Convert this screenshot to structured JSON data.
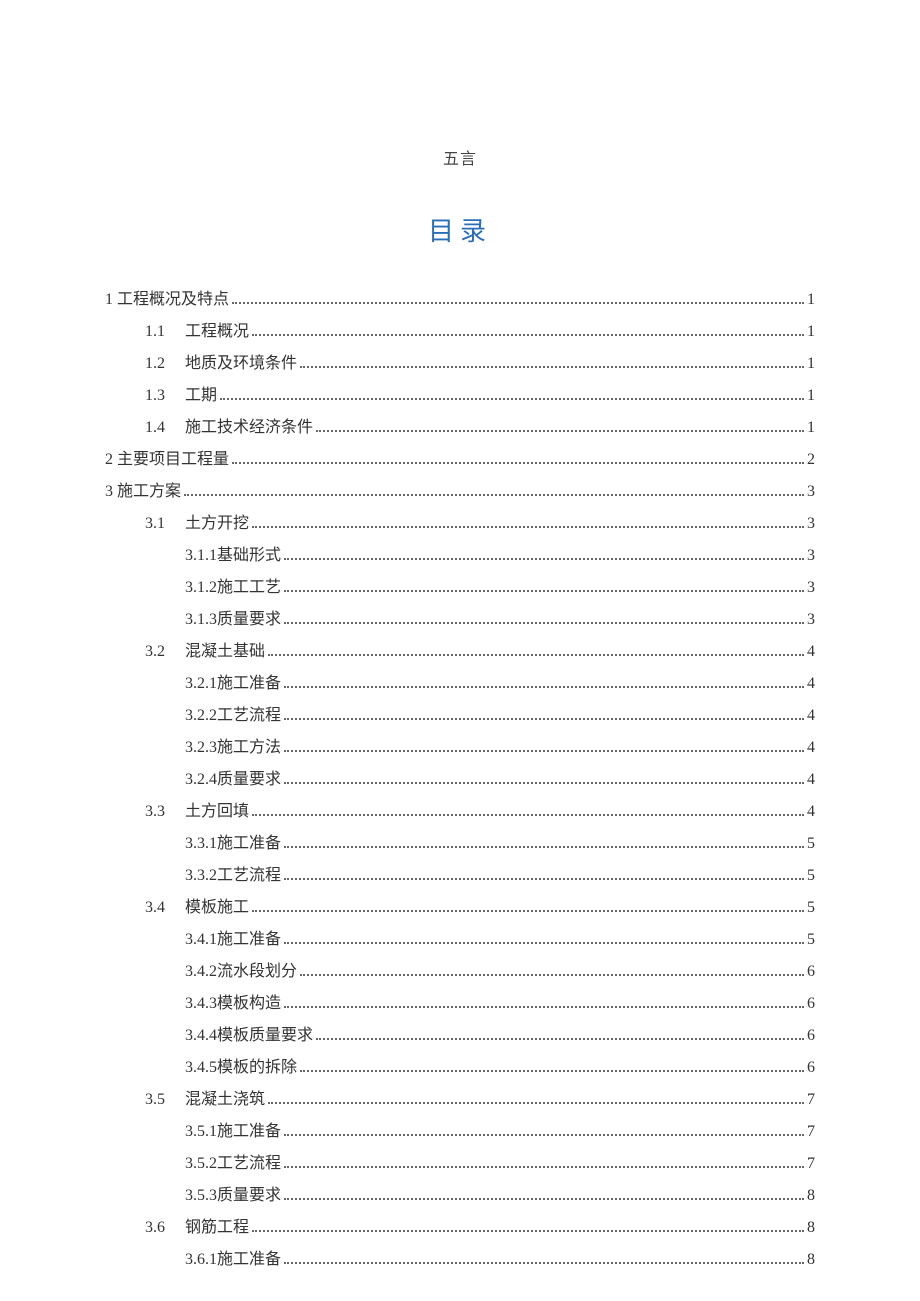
{
  "header_label": "五言",
  "title": "目录",
  "toc": [
    {
      "level": 0,
      "num": "1",
      "text": "工程概况及特点",
      "page": "1"
    },
    {
      "level": 1,
      "num": "1.1",
      "text": "工程概况",
      "page": "1"
    },
    {
      "level": 1,
      "num": "1.2",
      "text": "地质及环境条件",
      "page": "1"
    },
    {
      "level": 1,
      "num": "1.3",
      "text": "工期",
      "page": "1"
    },
    {
      "level": 1,
      "num": "1.4",
      "text": "施工技术经济条件",
      "page": "1"
    },
    {
      "level": 0,
      "num": "2",
      "text": "主要项目工程量",
      "page": "2"
    },
    {
      "level": 0,
      "num": "3",
      "text": "施工方案",
      "page": "3"
    },
    {
      "level": 1,
      "num": "3.1",
      "text": "土方开挖",
      "page": "3"
    },
    {
      "level": 2,
      "num": "3.1.1",
      "text": "基础形式",
      "page": "3"
    },
    {
      "level": 2,
      "num": "3.1.2",
      "text": "施工工艺",
      "page": "3"
    },
    {
      "level": 2,
      "num": "3.1.3",
      "text": "质量要求",
      "page": "3"
    },
    {
      "level": 1,
      "num": "3.2",
      "text": "混凝土基础",
      "page": "4"
    },
    {
      "level": 2,
      "num": "3.2.1",
      "text": "施工准备",
      "page": "4"
    },
    {
      "level": 2,
      "num": "3.2.2",
      "text": "工艺流程",
      "page": "4"
    },
    {
      "level": 2,
      "num": "3.2.3",
      "text": "施工方法",
      "page": "4"
    },
    {
      "level": 2,
      "num": "3.2.4",
      "text": "质量要求",
      "page": "4"
    },
    {
      "level": 1,
      "num": "3.3",
      "text": "土方回填",
      "page": "4"
    },
    {
      "level": 2,
      "num": "3.3.1",
      "text": "施工准备",
      "page": "5"
    },
    {
      "level": 2,
      "num": "3.3.2",
      "text": "工艺流程",
      "page": "5"
    },
    {
      "level": 1,
      "num": "3.4",
      "text": "模板施工",
      "page": "5"
    },
    {
      "level": 2,
      "num": "3.4.1",
      "text": "施工准备",
      "page": "5"
    },
    {
      "level": 2,
      "num": "3.4.2",
      "text": "流水段划分",
      "page": "6"
    },
    {
      "level": 2,
      "num": "3.4.3",
      "text": "模板构造",
      "page": "6"
    },
    {
      "level": 2,
      "num": "3.4.4",
      "text": "模板质量要求",
      "page": "6"
    },
    {
      "level": 2,
      "num": "3.4.5",
      "text": "模板的拆除",
      "page": "6"
    },
    {
      "level": 1,
      "num": "3.5",
      "text": "混凝土浇筑",
      "page": "7"
    },
    {
      "level": 2,
      "num": "3.5.1",
      "text": "施工准备",
      "page": "7"
    },
    {
      "level": 2,
      "num": "3.5.2",
      "text": "工艺流程",
      "page": "7"
    },
    {
      "level": 2,
      "num": "3.5.3",
      "text": "质量要求",
      "page": "8"
    },
    {
      "level": 1,
      "num": "3.6",
      "text": "钢筋工程",
      "page": "8"
    },
    {
      "level": 2,
      "num": "3.6.1",
      "text": "施工准备",
      "page": "8"
    }
  ]
}
